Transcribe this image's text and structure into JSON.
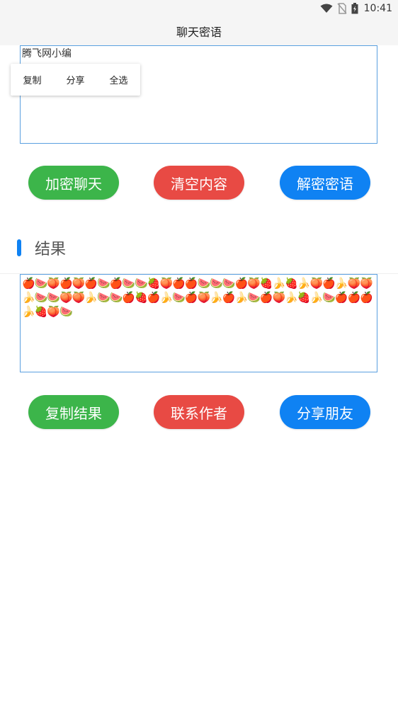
{
  "status_bar": {
    "time": "10:41",
    "icons": [
      "wifi-icon",
      "no-sim-icon",
      "battery-charging-icon"
    ]
  },
  "header": {
    "title": "聊天密语"
  },
  "input": {
    "value": "腾飞网小编"
  },
  "context_menu": {
    "copy": "复制",
    "share": "分享",
    "select_all": "全选"
  },
  "actions": {
    "encrypt": "加密聊天",
    "clear": "清空内容",
    "decrypt": "解密密语"
  },
  "result": {
    "section_title": "结果",
    "value": "🍎🍉🍑🍎🍑🍎🍉🍎🍉🍉🍓🍑🍎🍎🍉🍉🍉🍎🍑🍓🍌🍓🍌🍑🍎🍌🍑🍑🍌🍉🍉🍑🍑🍌🍉🍉🍎🍓🍎🍌🍉🍎🍑🍌🍎🍌🍉🍎🍑🍌🍓🍌🍉🍎🍎🍎🍌🍓🍑🍉"
  },
  "result_actions": {
    "copy_result": "复制结果",
    "contact_author": "联系作者",
    "share_friends": "分享朋友"
  },
  "colors": {
    "green": "#3cb54a",
    "red": "#e84a44",
    "blue": "#0f82f3",
    "textbox_border": "#5aa0e0"
  }
}
